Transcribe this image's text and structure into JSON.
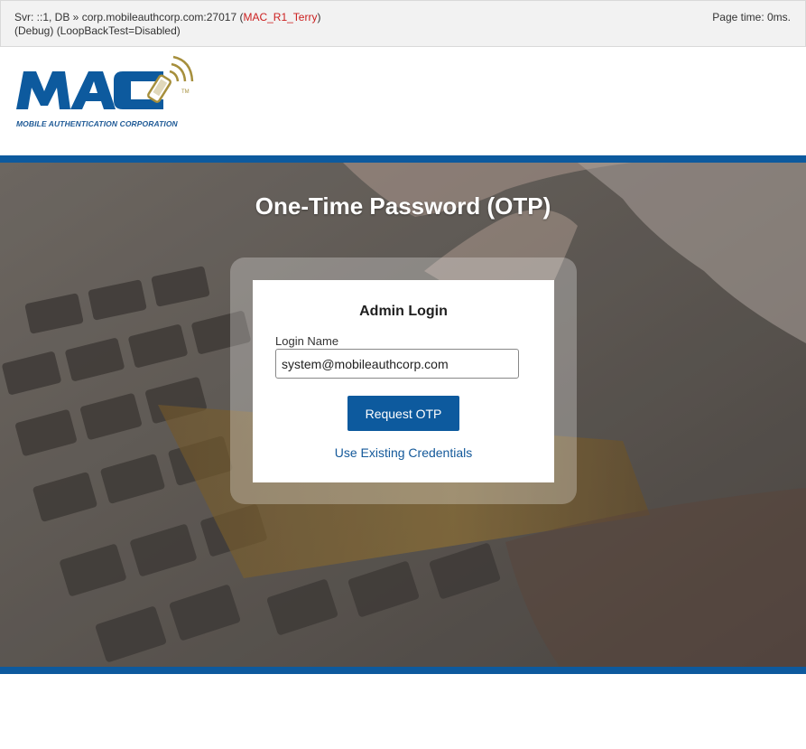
{
  "debug": {
    "server_prefix": "Svr: ::1,  DB » corp.mobileauthcorp.com:27017 (",
    "user": "MAC_R1_Terry",
    "server_suffix": ")",
    "mode": "(Debug) (LoopBackTest=Disabled)",
    "page_time": "Page time: 0ms."
  },
  "brand": {
    "logo_text": "MAC",
    "trademark": "TM",
    "caption": "MOBILE AUTHENTICATION CORPORATION",
    "primary_color": "#0d5a9e",
    "accent_color": "#a68f3c"
  },
  "hero": {
    "title": "One-Time Password (OTP)"
  },
  "login": {
    "title": "Admin Login",
    "field_label": "Login Name",
    "login_value": "system@mobileauthcorp.com",
    "submit_label": "Request OTP",
    "alt_link": "Use Existing Credentials"
  }
}
